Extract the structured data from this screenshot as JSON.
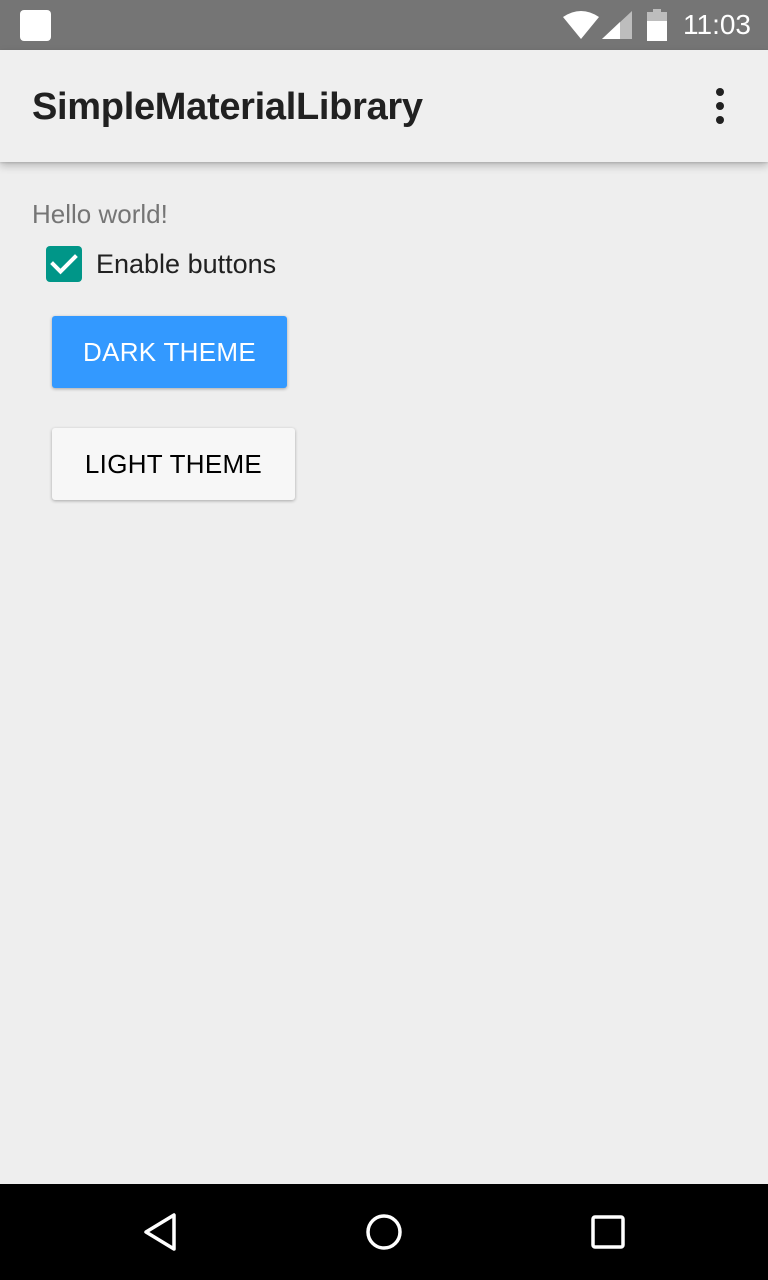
{
  "status_bar": {
    "time": "11:03",
    "icons": [
      "notification-icon",
      "wifi-icon",
      "signal-icon",
      "battery-icon"
    ]
  },
  "app_bar": {
    "title": "SimpleMaterialLibrary",
    "menu_icon": "more-vert-icon"
  },
  "content": {
    "hello_text": "Hello world!",
    "checkbox": {
      "label": "Enable buttons",
      "checked": true,
      "color": "#009688"
    },
    "buttons": {
      "dark_label": "DARK THEME",
      "dark_color": "#3399ff",
      "light_label": "LIGHT THEME",
      "light_color": "#f7f7f7"
    }
  },
  "nav_bar": {
    "icons": [
      "back-icon",
      "home-icon",
      "recents-icon"
    ]
  },
  "colors": {
    "status_bar": "#757575",
    "app_bar": "#efefef",
    "background": "#eeeeee",
    "nav_bar": "#000000"
  }
}
